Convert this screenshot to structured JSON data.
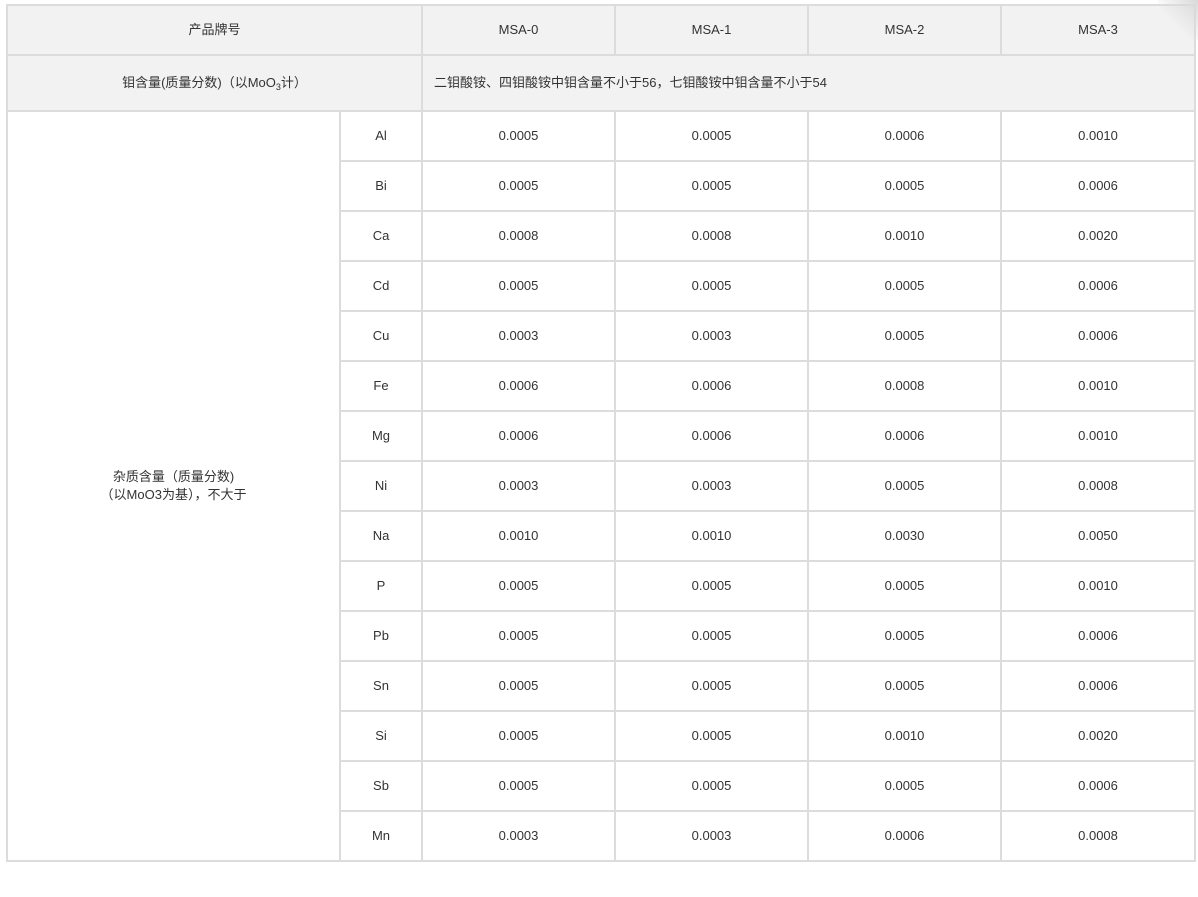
{
  "table": {
    "header": {
      "brand_label": "产品牌号",
      "grades": [
        "MSA-0",
        "MSA-1",
        "MSA-2",
        "MSA-3"
      ]
    },
    "mo_content": {
      "label_prefix": "钼含量(质量分数)（以MoO",
      "label_sub": "3",
      "label_suffix": "计）",
      "note": "二钼酸铵、四钼酸铵中钼含量不小于56，七钼酸铵中钼含量不小于54"
    },
    "impurity": {
      "label_line1": "杂质含量（质量分数)",
      "label_line2": "（以MoO3为基），不大于"
    },
    "rows": [
      {
        "element": "Al",
        "values": [
          "0.0005",
          "0.0005",
          "0.0006",
          "0.0010"
        ]
      },
      {
        "element": "Bi",
        "values": [
          "0.0005",
          "0.0005",
          "0.0005",
          "0.0006"
        ]
      },
      {
        "element": "Ca",
        "values": [
          "0.0008",
          "0.0008",
          "0.0010",
          "0.0020"
        ]
      },
      {
        "element": "Cd",
        "values": [
          "0.0005",
          "0.0005",
          "0.0005",
          "0.0006"
        ]
      },
      {
        "element": "Cu",
        "values": [
          "0.0003",
          "0.0003",
          "0.0005",
          "0.0006"
        ]
      },
      {
        "element": "Fe",
        "values": [
          "0.0006",
          "0.0006",
          "0.0008",
          "0.0010"
        ]
      },
      {
        "element": "Mg",
        "values": [
          "0.0006",
          "0.0006",
          "0.0006",
          "0.0010"
        ]
      },
      {
        "element": "Ni",
        "values": [
          "0.0003",
          "0.0003",
          "0.0005",
          "0.0008"
        ]
      },
      {
        "element": "Na",
        "values": [
          "0.0010",
          "0.0010",
          "0.0030",
          "0.0050"
        ]
      },
      {
        "element": "P",
        "values": [
          "0.0005",
          "0.0005",
          "0.0005",
          "0.0010"
        ]
      },
      {
        "element": "Pb",
        "values": [
          "0.0005",
          "0.0005",
          "0.0005",
          "0.0006"
        ]
      },
      {
        "element": "Sn",
        "values": [
          "0.0005",
          "0.0005",
          "0.0005",
          "0.0006"
        ]
      },
      {
        "element": "Si",
        "values": [
          "0.0005",
          "0.0005",
          "0.0010",
          "0.0020"
        ]
      },
      {
        "element": "Sb",
        "values": [
          "0.0005",
          "0.0005",
          "0.0005",
          "0.0006"
        ]
      },
      {
        "element": "Mn",
        "values": [
          "0.0003",
          "0.0003",
          "0.0006",
          "0.0008"
        ]
      }
    ]
  }
}
